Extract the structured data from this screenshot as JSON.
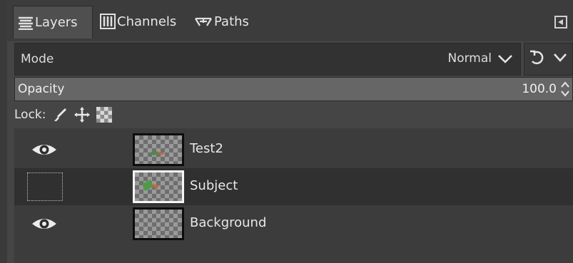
{
  "tabs": [
    {
      "label": "Layers",
      "icon": "layers-icon",
      "active": true
    },
    {
      "label": "Channels",
      "icon": "channels-icon",
      "active": false
    },
    {
      "label": "Paths",
      "icon": "paths-icon",
      "active": false
    }
  ],
  "mode": {
    "label": "Mode",
    "value": "Normal"
  },
  "opacity": {
    "label": "Opacity",
    "value": "100.0",
    "fraction": 1.0
  },
  "lock": {
    "label": "Lock:",
    "icons": [
      "paintbrush-icon",
      "move-icon",
      "checkerboard-icon"
    ]
  },
  "layers": [
    {
      "name": "Test2",
      "visible": true,
      "selected": false
    },
    {
      "name": "Subject",
      "visible": false,
      "selected": true
    },
    {
      "name": "Background",
      "visible": true,
      "selected": false
    }
  ],
  "colors": {
    "panel": "#454545",
    "list": "#3c3c3c",
    "selected_row": "#303030",
    "text": "#dcdcdc"
  }
}
